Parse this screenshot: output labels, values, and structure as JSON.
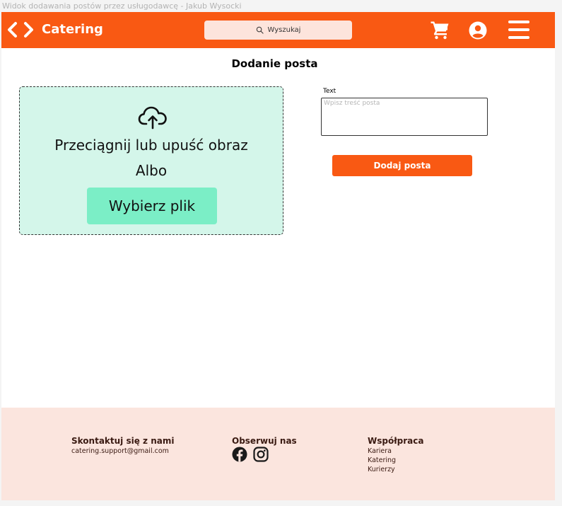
{
  "frame": {
    "title": "Widok dodawania postów przez usługodawcę - Jakub Wysocki"
  },
  "header": {
    "brand": "Catering",
    "search_placeholder": "Wyszukaj",
    "icons": [
      "chevron-left-icon",
      "chevron-right-icon",
      "search-icon",
      "cart-icon",
      "user-icon",
      "menu-icon"
    ]
  },
  "main": {
    "title": "Dodanie posta",
    "upload": {
      "drop_text": "Przeciągnij lub upuść obraz",
      "or_text": "Albo",
      "choose_button": "Wybierz plik"
    },
    "form": {
      "text_label": "Text",
      "text_placeholder": "Wpisz treść posta",
      "text_value": "",
      "submit_label": "Dodaj posta"
    }
  },
  "footer": {
    "contact": {
      "heading": "Skontaktuj się z nami",
      "email": "catering.support@gmail.com"
    },
    "follow": {
      "heading": "Obserwuj nas",
      "icons": [
        "facebook-icon",
        "instagram-icon"
      ]
    },
    "cooperation": {
      "heading": "Współpraca",
      "links": [
        "Kariera",
        "Katering",
        "Kurierzy"
      ]
    }
  },
  "colors": {
    "brand_orange": "#f95913",
    "search_bg": "#fde4dc",
    "dropzone_bg": "#d4f6ea",
    "choose_button_bg": "#7beec6",
    "footer_bg": "#fbe5de"
  }
}
